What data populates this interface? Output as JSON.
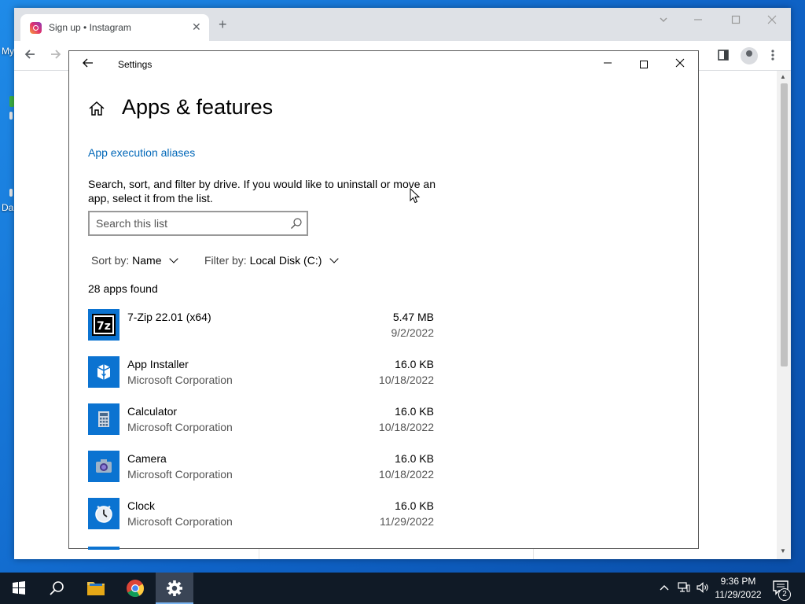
{
  "desktop": {
    "label_top": "My",
    "label_bottom": "Da"
  },
  "browser": {
    "tab_title": "Sign up • Instagram",
    "tab_close": "✕",
    "new_tab": "+"
  },
  "settings": {
    "window_title": "Settings",
    "page_title": "Apps & features",
    "link_label": "App execution aliases",
    "description": "Search, sort, and filter by drive. If you would like to uninstall or move an app, select it from the list.",
    "search_placeholder": "Search this list",
    "sort_label": "Sort by:",
    "sort_value": "Name",
    "filter_label": "Filter by:",
    "filter_value": "Local Disk (C:)",
    "count_text": "28 apps found",
    "apps": [
      {
        "name": "7-Zip 22.01 (x64)",
        "publisher": "",
        "size": "5.47 MB",
        "date": "9/2/2022",
        "icon": "7zip-icon"
      },
      {
        "name": "App Installer",
        "publisher": "Microsoft Corporation",
        "size": "16.0 KB",
        "date": "10/18/2022",
        "icon": "app-installer-icon"
      },
      {
        "name": "Calculator",
        "publisher": "Microsoft Corporation",
        "size": "16.0 KB",
        "date": "10/18/2022",
        "icon": "calculator-icon"
      },
      {
        "name": "Camera",
        "publisher": "Microsoft Corporation",
        "size": "16.0 KB",
        "date": "10/18/2022",
        "icon": "camera-icon"
      },
      {
        "name": "Clock",
        "publisher": "Microsoft Corporation",
        "size": "16.0 KB",
        "date": "11/29/2022",
        "icon": "clock-icon"
      }
    ]
  },
  "taskbar": {
    "time": "9:36 PM",
    "date": "11/29/2022",
    "notification_count": "2"
  },
  "colors": {
    "accent": "#0067b8",
    "app_tile": "#0b73d1",
    "taskbar": "#101a26"
  }
}
